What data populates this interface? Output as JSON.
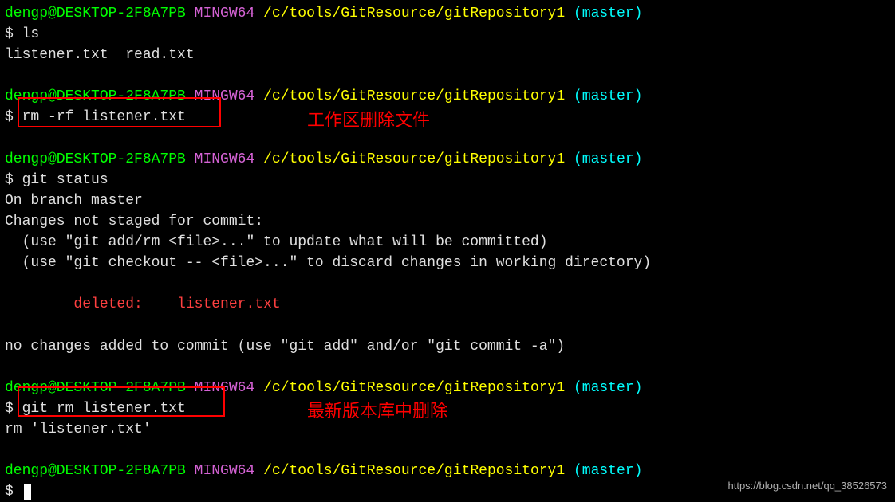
{
  "prompt": {
    "user_host": "dengp@DESKTOP-2F8A7PB",
    "env": "MINGW64",
    "path": "/c/tools/GitResource/gitRepository1",
    "branch": "(master)"
  },
  "blocks": {
    "b1": {
      "cmd_prefix": "$ ",
      "cmd": "ls",
      "out1": "listener.txt  read.txt"
    },
    "b2": {
      "cmd_prefix": "$ ",
      "cmd": "rm -rf listener.txt"
    },
    "b3": {
      "cmd_prefix": "$ ",
      "cmd": "git status",
      "out1": "On branch master",
      "out2": "Changes not staged for commit:",
      "out3": "  (use \"git add/rm <file>...\" to update what will be committed)",
      "out4": "  (use \"git checkout -- <file>...\" to discard changes in working directory)",
      "deleted_label": "        deleted:    ",
      "deleted_file": "listener.txt",
      "out5": "no changes added to commit (use \"git add\" and/or \"git commit -a\")"
    },
    "b4": {
      "cmd_prefix": "$ ",
      "cmd": "git rm listener.txt",
      "out1": "rm 'listener.txt'"
    },
    "b5": {
      "cmd_prefix": "$ "
    }
  },
  "annotations": {
    "a1": "工作区删除文件",
    "a2": "最新版本库中删除"
  },
  "watermark": "https://blog.csdn.net/qq_38526573"
}
